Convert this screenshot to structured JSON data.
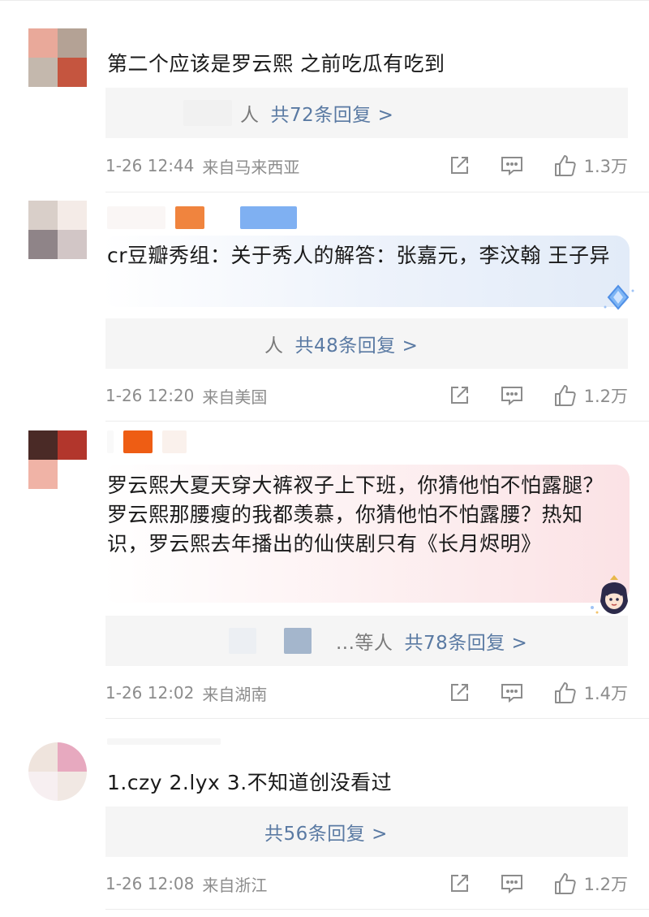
{
  "comments": [
    {
      "text": "第二个应该是罗云熙 之前吃瓜有吃到",
      "reply_prefix": "人",
      "reply_count": "共72条回复 >",
      "time": "1-26 12:44",
      "location": "来自马来西亚",
      "likes": "1.3万"
    },
    {
      "text": "cr豆瓣秀组：关于秀人的解答：张嘉元，李汶翰 王子异",
      "reply_prefix": "人",
      "reply_count": "共48条回复 >",
      "time": "1-26 12:20",
      "location": "来自美国",
      "likes": "1.2万"
    },
    {
      "text": "罗云熙大夏天穿大裤衩子上下班，你猜他怕不怕露腿？罗云熙那腰瘦的我都羡慕，你猜他怕不怕露腰？热知识，罗云熙去年播出的仙侠剧只有《长月烬明》",
      "reply_prefix": "...等人",
      "reply_count": "共78条回复 >",
      "time": "1-26 12:02",
      "location": "来自湖南",
      "likes": "1.4万"
    },
    {
      "text": "1.czy 2.lyx 3.不知道创没看过",
      "reply_prefix": "",
      "reply_count": "共56条回复 >",
      "time": "1-26 12:08",
      "location": "来自浙江",
      "likes": "1.2万"
    }
  ],
  "colors": {
    "link": "#5a7aa3",
    "meta": "#8c8c8c",
    "reply_bg": "#f5f5f5",
    "divider": "#ececec"
  },
  "icons": [
    "share-icon",
    "comment-icon",
    "like-icon",
    "diamond-badge-icon",
    "character-sticker-icon"
  ]
}
